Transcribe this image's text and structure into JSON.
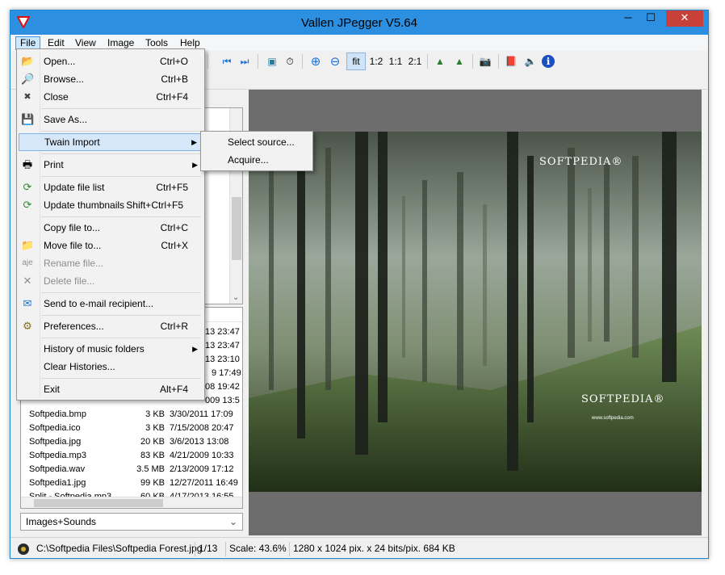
{
  "window": {
    "title": "Vallen JPegger V5.64",
    "minimize_glyph": "─",
    "maximize_glyph": "☐",
    "close_glyph": "✕"
  },
  "menubar": {
    "items": [
      "File",
      "Edit",
      "View",
      "Image",
      "Tools",
      "Help"
    ],
    "active": "File"
  },
  "toolbar": {
    "buttons": [
      {
        "icon": "first-image-icon",
        "glyph": "⏮"
      },
      {
        "icon": "last-image-icon",
        "glyph": "⏭"
      },
      {
        "icon": "slideshow-icon",
        "glyph": "▣"
      },
      {
        "icon": "timer-icon",
        "glyph": "⏱"
      },
      {
        "icon": "zoom-in-icon",
        "glyph": "⊕"
      },
      {
        "icon": "zoom-out-icon",
        "glyph": "⊖"
      },
      {
        "icon": "fit-icon",
        "label": "fit"
      },
      {
        "icon": "zoom-half-icon",
        "label": "1:2"
      },
      {
        "icon": "zoom-actual-icon",
        "label": "1:1"
      },
      {
        "icon": "zoom-double-icon",
        "label": "2:1"
      },
      {
        "icon": "mountain-left-icon",
        "glyph": "▲"
      },
      {
        "icon": "mountain-right-icon",
        "glyph": "▲"
      },
      {
        "icon": "camera-icon",
        "glyph": "📷"
      },
      {
        "icon": "book-icon",
        "glyph": "📕"
      },
      {
        "icon": "speaker-icon",
        "glyph": "🔈"
      },
      {
        "icon": "info-icon",
        "glyph": "ℹ"
      }
    ]
  },
  "file_menu": {
    "items": [
      {
        "icon": "open-folder-icon",
        "glyph": "📂",
        "label": "Open...",
        "shortcut": "Ctrl+O"
      },
      {
        "icon": "browse-icon",
        "glyph": "🔎",
        "label": "Browse...",
        "shortcut": "Ctrl+B"
      },
      {
        "icon": "close-file-icon",
        "glyph": "✖",
        "label": "Close",
        "shortcut": "Ctrl+F4"
      },
      {
        "icon": "save-icon",
        "glyph": "💾",
        "label": "Save As...",
        "shortcut": ""
      },
      {
        "icon": "",
        "glyph": "",
        "label": "Twain Import",
        "shortcut": "",
        "submenu": true
      },
      {
        "icon": "printer-icon",
        "glyph": "🖶",
        "label": "Print",
        "shortcut": "",
        "submenu": true
      },
      {
        "icon": "refresh-list-icon",
        "glyph": "⟳",
        "label": "Update file list",
        "shortcut": "Ctrl+F5"
      },
      {
        "icon": "refresh-thumbs-icon",
        "glyph": "⟳",
        "label": "Update thumbnails",
        "shortcut": "Shift+Ctrl+F5"
      },
      {
        "icon": "",
        "glyph": "",
        "label": "Copy file to...",
        "shortcut": "Ctrl+C"
      },
      {
        "icon": "move-file-icon",
        "glyph": "📁",
        "label": "Move file to...",
        "shortcut": "Ctrl+X"
      },
      {
        "icon": "rename-icon",
        "glyph": "aje",
        "label": "Rename file...",
        "shortcut": "",
        "disabled": true
      },
      {
        "icon": "delete-icon",
        "glyph": "✕",
        "label": "Delete file...",
        "shortcut": "",
        "disabled": true
      },
      {
        "icon": "email-icon",
        "glyph": "✉",
        "label": "Send to e-mail recipient...",
        "shortcut": ""
      },
      {
        "icon": "preferences-icon",
        "glyph": "⚙",
        "label": "Preferences...",
        "shortcut": "Ctrl+R"
      },
      {
        "icon": "",
        "glyph": "",
        "label": "History of music folders",
        "shortcut": "",
        "submenu": true
      },
      {
        "icon": "",
        "glyph": "",
        "label": "Clear Histories...",
        "shortcut": ""
      },
      {
        "icon": "",
        "glyph": "",
        "label": "Exit",
        "shortcut": "Alt+F4"
      }
    ],
    "submenu_arrow": "▶"
  },
  "twain_submenu": {
    "items": [
      "Select source...",
      "Acquire..."
    ]
  },
  "file_list": {
    "partial_dates": [
      "13 23:47",
      "13 23:47",
      "13 23:10",
      "9 17:49",
      "08 19:42",
      "009 13:5"
    ],
    "rows": [
      {
        "name": "Softpedia.bmp",
        "size": "3 KB",
        "date": "3/30/2011 17:09"
      },
      {
        "name": "Softpedia.ico",
        "size": "3 KB",
        "date": "7/15/2008 20:47"
      },
      {
        "name": "Softpedia.jpg",
        "size": "20 KB",
        "date": "3/6/2013 13:08"
      },
      {
        "name": "Softpedia.mp3",
        "size": "83 KB",
        "date": "4/21/2009 10:33"
      },
      {
        "name": "Softpedia.wav",
        "size": "3.5 MB",
        "date": "2/13/2009 17:12"
      },
      {
        "name": "Softpedia1.jpg",
        "size": "99 KB",
        "date": "12/27/2011 16:49"
      },
      {
        "name": "Split - Softpedia.mp3",
        "size": "60 KB",
        "date": "4/17/2013 16:55"
      }
    ]
  },
  "filter": {
    "value": "Images+Sounds",
    "chevron": "⌄"
  },
  "tree": {
    "scroll_down": "⌄"
  },
  "viewer": {
    "watermark_top": "SOFTPEDIA®",
    "watermark_bottom": "SOFTPEDIA®",
    "watermark_url": "www.softpedia.com",
    "watermark_behind": "SOFTPEDIA"
  },
  "statusbar": {
    "path": "C:\\Softpedia Files\\Softpedia Forest.jpg",
    "index": "1/13",
    "scale": "Scale: 43.6%",
    "info": "1280 x 1024 pix. x 24 bits/pix. 684 KB"
  },
  "colors": {
    "titlebar": "#2c8fe0",
    "close": "#c7403a",
    "menu_highlight": "#d5e7f8",
    "viewer_bg": "#6d6d6d"
  }
}
